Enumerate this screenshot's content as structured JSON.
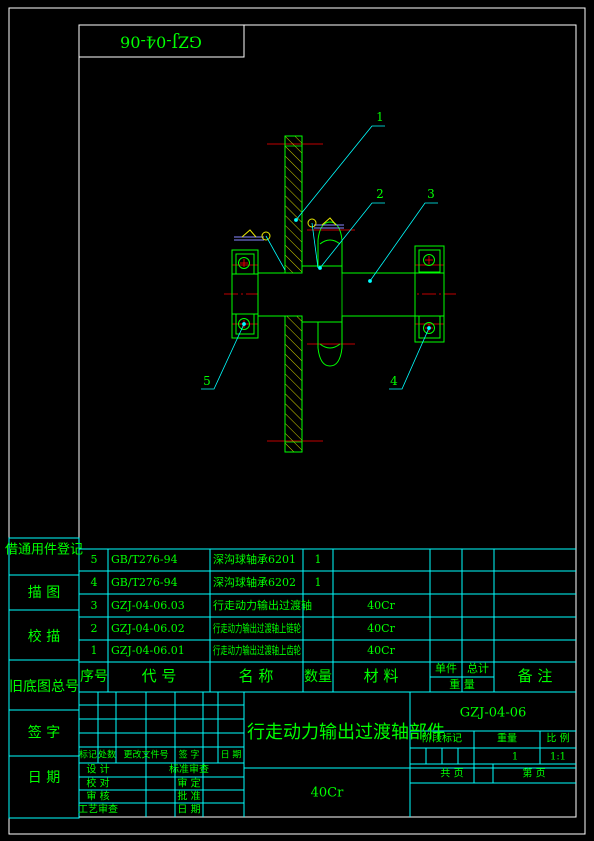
{
  "drawing_code_stamp": "GZJ-04-06",
  "balloons": [
    "1",
    "2",
    "3",
    "4",
    "5"
  ],
  "side_labels": [
    "借通用件登记",
    "描 图",
    "校 描",
    "旧底图总号",
    "签 字",
    "日 期"
  ],
  "bom": {
    "rows": [
      {
        "no": "5",
        "code": "GB/T276-94",
        "name": "深沟球轴承6201",
        "qty": "1",
        "material": ""
      },
      {
        "no": "4",
        "code": "GB/T276-94",
        "name": "深沟球轴承6202",
        "qty": "1",
        "material": ""
      },
      {
        "no": "3",
        "code": "GZJ-04-06.03",
        "name": "行走动力输出过渡轴",
        "qty": "",
        "material": "40Cr"
      },
      {
        "no": "2",
        "code": "GZJ-04-06.02",
        "name": "行走动力输出过渡轴上链轮",
        "qty": "",
        "material": "40Cr"
      },
      {
        "no": "1",
        "code": "GZJ-04-06.01",
        "name": "行走动力输出过渡轴上齿轮",
        "qty": "",
        "material": "40Cr"
      }
    ],
    "header": {
      "no": "序号",
      "code": "代 号",
      "name": "名 称",
      "qty": "数量",
      "material": "材 料",
      "unit_weight_top": "单件",
      "total_weight_top": "总计",
      "weight_bottom": "重 量",
      "remark": "备 注"
    }
  },
  "title_block": {
    "part_name": "行走动力输出过渡轴部件",
    "drawing_no": "GZJ-04-06",
    "material": "40Cr",
    "stage_mark_label": "阶段标记",
    "weight_label": "重量",
    "scale_label": "比 例",
    "quantity": "1",
    "scale": "1:1",
    "sheet_total": "共 页",
    "sheet_no": "第 页",
    "revision_headers": [
      "标记",
      "处数",
      "更改文件号",
      "签 字",
      "日 期"
    ],
    "roles_left": [
      "设 计",
      "校 对",
      "审 核",
      "工艺审查"
    ],
    "roles_right": [
      "标准审查",
      "审 定",
      "批 准",
      "日 期"
    ]
  },
  "colors": {
    "frame": "#ffffff",
    "table": "#00ffff",
    "text": "#00ff00",
    "centerline": "#ff0000",
    "part_outline": "#00ff00",
    "hatch": "#e8e800",
    "leader": "#00ffff"
  }
}
